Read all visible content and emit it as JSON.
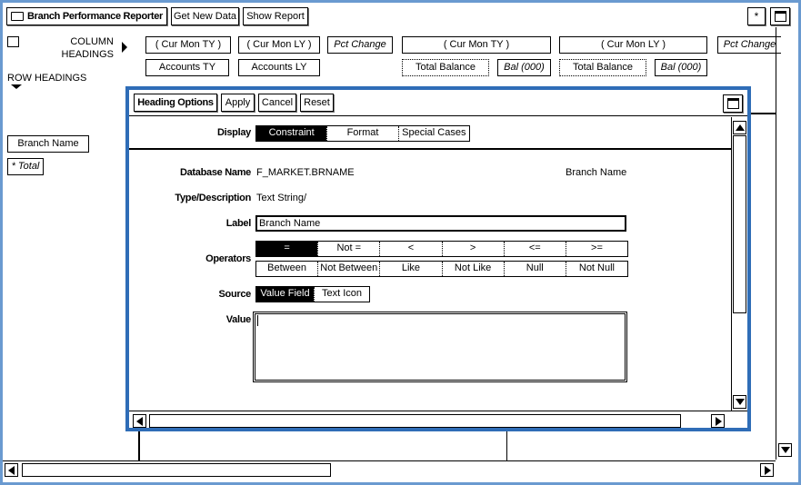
{
  "toolbar": {
    "app_title": "Branch Performance Reporter",
    "get_new_data": "Get New Data",
    "show_report": "Show Report"
  },
  "layout_labels": {
    "column_headings": [
      "COLUMN",
      "HEADINGS"
    ],
    "row_headings": "ROW HEADINGS"
  },
  "column_headings_row1": [
    "( Cur Mon TY )",
    "( Cur Mon LY )",
    "Pct Change",
    "( Cur Mon TY )",
    "( Cur Mon LY )",
    "Pct Change"
  ],
  "column_headings_row2": [
    "Accounts TY",
    "Accounts LY",
    "Total Balance",
    "Bal (000)",
    "Total Balance",
    "Bal (000)"
  ],
  "row_headings": [
    "Branch Name",
    "* Total"
  ],
  "dialog": {
    "title": "Heading Options",
    "apply": "Apply",
    "cancel": "Cancel",
    "reset": "Reset",
    "display_label": "Display",
    "display_tabs": [
      "Constraint",
      "Format",
      "Special Cases"
    ],
    "display_selected": "Constraint",
    "database_name_label": "Database Name",
    "database_name_value": "F_MARKET.BRNAME",
    "database_name_caption": "Branch Name",
    "type_label": "Type/Description",
    "type_value": "Text String/",
    "label_label": "Label",
    "label_value": "Branch Name",
    "operators_label": "Operators",
    "operators_row1": [
      "=",
      "Not =",
      "<",
      ">",
      "<=",
      ">="
    ],
    "operators_row2": [
      "Between",
      "Not Between",
      "Like",
      "Not Like",
      "Null",
      "Not Null"
    ],
    "operator_selected": "=",
    "source_label": "Source",
    "source_options": [
      "Value Field",
      "Text Icon"
    ],
    "source_selected": "Value Field",
    "value_label": "Value",
    "value_text": ""
  },
  "colors": {
    "window_border": "#6a9ad0",
    "dialog_border": "#2f6db7",
    "selected_bg": "#000000"
  }
}
